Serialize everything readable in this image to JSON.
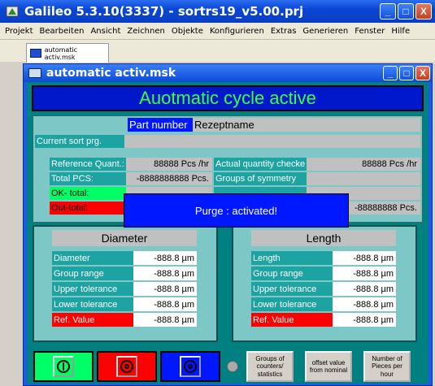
{
  "app": {
    "title": "Galileo 5.3.10(3337) - sortrs19_v5.00.prj",
    "controls": [
      "_",
      "□",
      "X"
    ]
  },
  "menu": [
    "Projekt",
    "Bearbeiten",
    "Ansicht",
    "Zeichnen",
    "Objekte",
    "Konfigurieren",
    "Extras",
    "Generieren",
    "Fenster",
    "Hilfe"
  ],
  "tab": {
    "label": "automatic activ.msk"
  },
  "inner_window": {
    "title": "automatic activ.msk",
    "controls": [
      "_",
      "□",
      "X"
    ]
  },
  "banner": "Auotmatic cycle active",
  "part": {
    "label": "Part number",
    "value": "Rezeptname"
  },
  "sort_prg": {
    "label": "Current sort prg.",
    "value": ""
  },
  "stats": {
    "ref_quant_label": "Reference Quant.:",
    "ref_quant_value": "88888 Pcs /hr",
    "actual_qty_label": "Actual quantity checke",
    "actual_qty_value": "88888 Pcs /hr",
    "total_label": "Total PCS:",
    "total_value": "-8888888888 Pcs.",
    "groups_label": "Groups of symmetry",
    "ok_label": "OK- total:",
    "out_label": "Out-total:",
    "right_value": "-88888888 Pcs."
  },
  "popup": "Purge : activated!",
  "diameter": {
    "header": "Diameter",
    "rows": [
      {
        "label": "Diameter",
        "value": "-888.8 µm"
      },
      {
        "label": "Group range",
        "value": "-888.8 µm"
      },
      {
        "label": "Upper tolerance",
        "value": "-888.8 µm"
      },
      {
        "label": "Lower tolerance",
        "value": "-888.8 µm"
      },
      {
        "label": "Ref. Value",
        "value": "-888.8 µm"
      }
    ]
  },
  "length": {
    "header": "Length",
    "rows": [
      {
        "label": "Length",
        "value": "-888.8 µm"
      },
      {
        "label": "Group range",
        "value": "-888.8 µm"
      },
      {
        "label": "Upper tolerance",
        "value": "-888.8 µm"
      },
      {
        "label": "Lower tolerance",
        "value": "-888.8 µm"
      },
      {
        "label": "Ref. Value",
        "value": "-888.8 µm"
      }
    ]
  },
  "buttons": {
    "groups_counters": "Groups of counters/ statistics",
    "offset_value": "offset value from nominal",
    "pieces_per_hour": "Number of Pieces per hour"
  },
  "colors": {
    "banner_bg": "#0018cc",
    "banner_text": "#3cff3c",
    "panel": "#7ec7c7",
    "label_teal": "#1ea3a3",
    "ok_green": "#00ff66",
    "out_red": "#ff0000",
    "start_btn": "#00ff66",
    "stop_btn": "#ff0000",
    "pause_btn": "#0018ff"
  },
  "icons": [
    "app-icon",
    "minimize-icon",
    "maximize-icon",
    "close-icon",
    "window-icon",
    "start-icon",
    "stop-icon",
    "pause-icon",
    "led-indicator"
  ]
}
